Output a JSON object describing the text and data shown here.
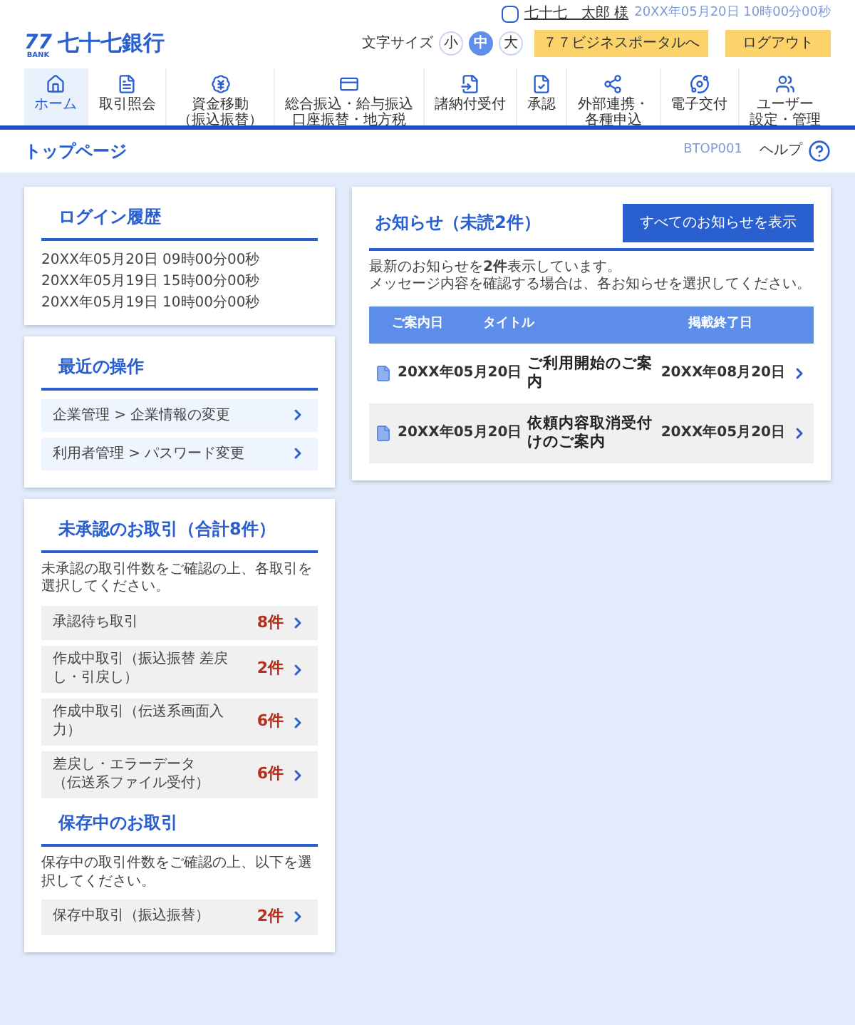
{
  "user": {
    "name": "七十七　太郎 様",
    "datetime": "20XX年05月20日 10時00分00秒"
  },
  "logo": {
    "mark": "77",
    "sub": "BANK",
    "name": "七十七銀行"
  },
  "font_size": {
    "label": "文字サイズ",
    "options": [
      {
        "label": "小",
        "selected": false
      },
      {
        "label": "中",
        "selected": true
      },
      {
        "label": "大",
        "selected": false
      }
    ]
  },
  "header_buttons": [
    "７７ビジネスポータルへ",
    "ログアウト"
  ],
  "nav": [
    {
      "label": "ホーム",
      "selected": true
    },
    {
      "label": "取引照会",
      "selected": false
    },
    {
      "label": [
        "資金移動",
        "（振込振替）"
      ],
      "selected": false
    },
    {
      "label": [
        "総合振込・給与振込",
        "口座振替・地方税"
      ],
      "selected": false
    },
    {
      "label": "諸納付受付",
      "selected": false
    },
    {
      "label": "承認",
      "selected": false
    },
    {
      "label": [
        "外部連携・",
        "各種申込"
      ],
      "selected": false
    },
    {
      "label": "電子交付",
      "selected": false
    },
    {
      "label": [
        "ユーザー",
        "設定・管理"
      ],
      "selected": false
    }
  ],
  "page": {
    "title": "トップページ",
    "screen_id": "BTOP001",
    "help": "ヘルプ"
  },
  "login_history": {
    "title": "ログイン履歴",
    "entries": [
      "20XX年05月20日 09時00分00秒",
      "20XX年05月19日 15時00分00秒",
      "20XX年05月19日 10時00分00秒"
    ]
  },
  "recent": {
    "title": "最近の操作",
    "items": [
      "企業管理 > 企業情報の変更",
      "利用者管理 > パスワード変更"
    ]
  },
  "unapproved": {
    "title": "未承認のお取引（合計8件）",
    "description": "未承認の取引件数をご確認の上、各取引を選択してください。",
    "items": [
      {
        "label": "承認待ち取引",
        "count": "8件"
      },
      {
        "label": "作成中取引（振込振替 差戻し・引戻し）",
        "count": "2件"
      },
      {
        "label": "作成中取引（伝送系画面入力）",
        "count": "6件"
      },
      {
        "label": [
          "差戻し・エラーデータ",
          "（伝送系ファイル受付）"
        ],
        "count": "6件"
      }
    ]
  },
  "saved": {
    "title": "保存中のお取引",
    "description": "保存中の取引件数をご確認の上、以下を選択してください。",
    "items": [
      {
        "label": "保存中取引（振込振替）",
        "count": "2件"
      }
    ]
  },
  "notices": {
    "title": "お知らせ（未読2件）",
    "button": "すべてのお知らせを表示",
    "message": [
      "最新のお知らせを**2件**表示しています。",
      "メッセージ内容を確認する場合は、各お知らせを選択してください。"
    ],
    "columns": [
      "ご案内日",
      "タイトル",
      "掲載終了日"
    ],
    "rows": [
      {
        "date": "20XX年05月20日",
        "title": "ご利用開始のご案内",
        "end_date": "20XX年08月20日"
      },
      {
        "date": "20XX年05月20日",
        "title": "依頼内容取消受付けのご案内",
        "end_date": "20XX年05月20日"
      }
    ]
  }
}
